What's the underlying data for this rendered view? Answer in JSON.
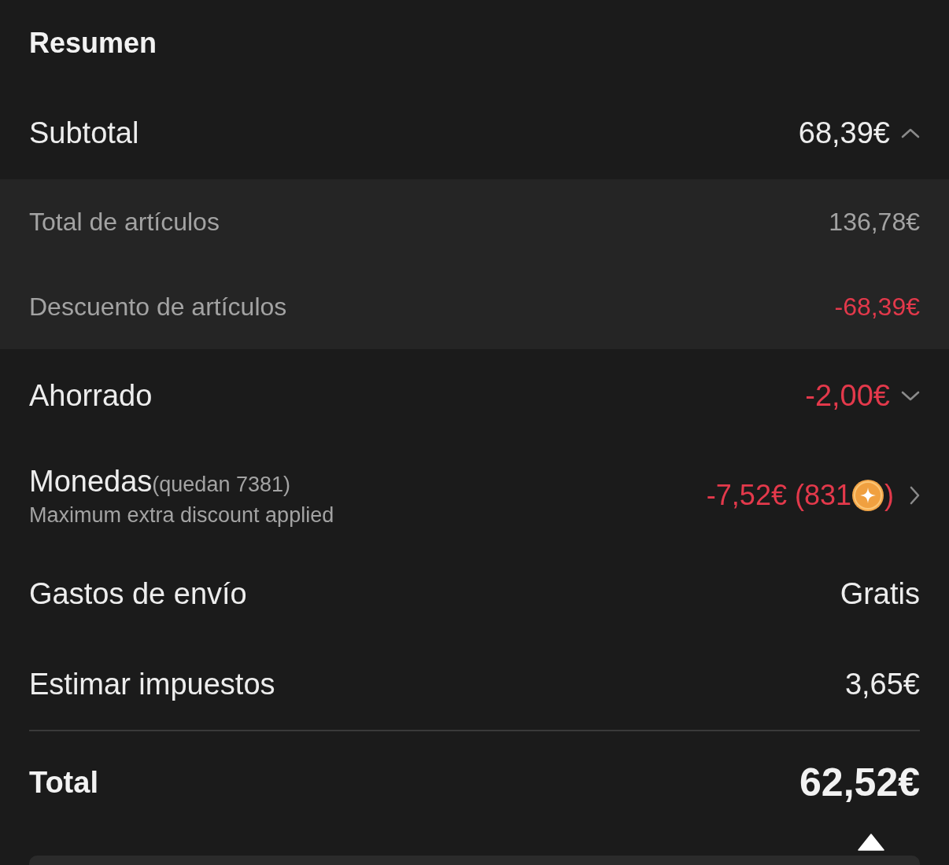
{
  "title": "Resumen",
  "rows": [
    {
      "kind": "expandable",
      "label": "Subtotal",
      "value": "68,39€",
      "negative": false,
      "expanded": true,
      "children": [
        {
          "label": "Total de artículos",
          "value": "136,78€",
          "negative": false
        },
        {
          "label": "Descuento de artículos",
          "value": "-68,39€",
          "negative": true
        }
      ]
    },
    {
      "kind": "expandable",
      "label": "Ahorrado",
      "value": "-2,00€",
      "negative": true,
      "expanded": false
    },
    {
      "kind": "link",
      "label": "Monedas",
      "note": "(quedan 7381)",
      "subtitle": "Maximum extra discount applied",
      "value": "-7,52€ (831",
      "value_end": ")",
      "negative": true
    },
    {
      "kind": "plain",
      "label": "Gastos de envío",
      "value": "Gratis",
      "negative": false
    },
    {
      "kind": "plain",
      "label": "Estimar impuestos",
      "value": "3,65€",
      "negative": false
    }
  ],
  "total": {
    "label": "Total",
    "value": "62,52€"
  }
}
